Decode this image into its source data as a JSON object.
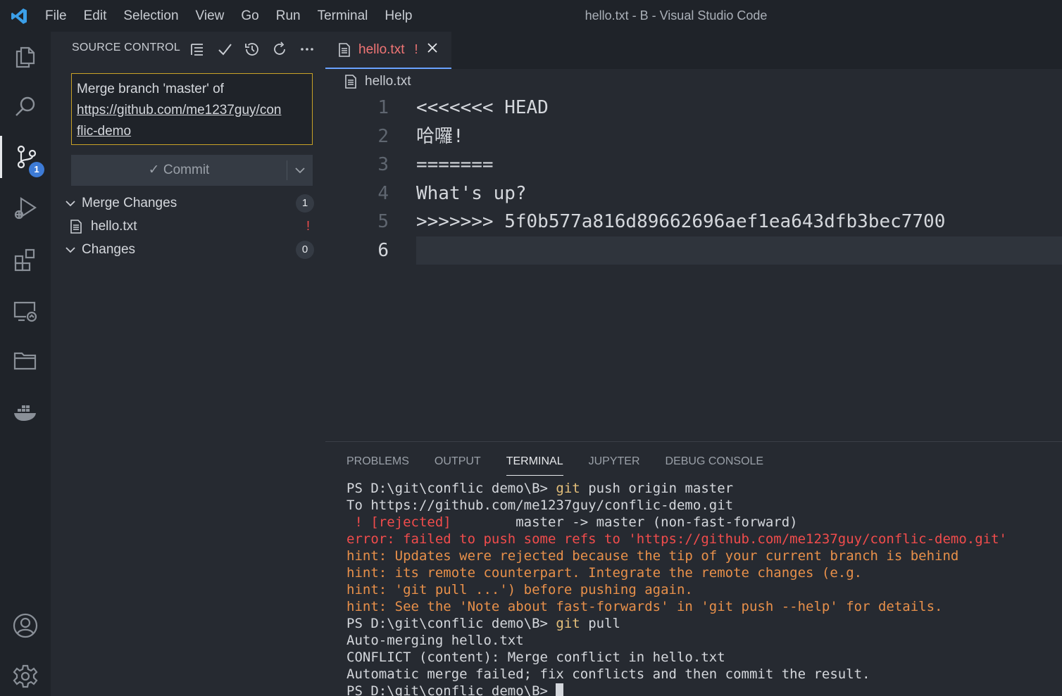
{
  "window": {
    "title": "hello.txt - B - Visual Studio Code"
  },
  "menu": [
    "File",
    "Edit",
    "Selection",
    "View",
    "Go",
    "Run",
    "Terminal",
    "Help"
  ],
  "activity_bar": {
    "items": [
      {
        "icon": "files-icon"
      },
      {
        "icon": "search-icon"
      },
      {
        "icon": "source-control-icon",
        "badge": "1",
        "active": true
      },
      {
        "icon": "run-debug-icon"
      },
      {
        "icon": "extensions-icon"
      },
      {
        "icon": "remote-explorer-icon"
      },
      {
        "icon": "folder-icon"
      },
      {
        "icon": "docker-icon"
      }
    ],
    "bottom": [
      {
        "icon": "account-icon"
      },
      {
        "icon": "gear-icon"
      }
    ]
  },
  "source_control": {
    "header": "SOURCE CONTROL",
    "header_icons": [
      "view-as-tree-icon",
      "check-icon",
      "history-icon",
      "refresh-icon",
      "more-icon"
    ],
    "message_line1": "Merge branch 'master' of",
    "message_line2": "https://github.com/me1237guy/con",
    "message_line3": "flic-demo",
    "commit_label": "✓ Commit",
    "groups": [
      {
        "label": "Merge Changes",
        "count": "1"
      },
      {
        "label": "Changes",
        "count": "0"
      }
    ],
    "file": {
      "name": "hello.txt",
      "status": "!"
    }
  },
  "editor": {
    "tab": {
      "name": "hello.txt",
      "status": "!"
    },
    "breadcrumb": "hello.txt",
    "lines": [
      {
        "n": "1",
        "text": "<<<<<<< HEAD"
      },
      {
        "n": "2",
        "text": "哈囉!"
      },
      {
        "n": "3",
        "text": "======="
      },
      {
        "n": "4",
        "text": "What's up?"
      },
      {
        "n": "5",
        "text": ">>>>>>> 5f0b577a816d89662696aef1ea643dfb3bec7700"
      },
      {
        "n": "6",
        "text": ""
      }
    ]
  },
  "panel": {
    "tabs": [
      "PROBLEMS",
      "OUTPUT",
      "TERMINAL",
      "JUPYTER",
      "DEBUG CONSOLE"
    ],
    "active_tab": "TERMINAL",
    "terminal": {
      "l1_prompt": "PS D:\\git\\conflic demo\\B> ",
      "l1_cmd": "git",
      "l1_args": " push origin master",
      "l2": "To https://github.com/me1237guy/conflic-demo.git",
      "l3_rejected": " ! [rejected]",
      "l3_rest": "        master -> master (non-fast-forward)",
      "l4": "error: failed to push some refs to 'https://github.com/me1237guy/conflic-demo.git'",
      "l5": "hint: Updates were rejected because the tip of your current branch is behind",
      "l6": "hint: its remote counterpart. Integrate the remote changes (e.g.",
      "l7": "hint: 'git pull ...') before pushing again.",
      "l8": "hint: See the 'Note about fast-forwards' in 'git push --help' for details.",
      "l9_prompt": "PS D:\\git\\conflic demo\\B> ",
      "l9_cmd": "git",
      "l9_args": " pull",
      "l10": "Auto-merging hello.txt",
      "l11": "CONFLICT (content): Merge conflict in hello.txt",
      "l12": "Automatic merge failed; fix conflicts and then commit the result.",
      "l13_prompt": "PS D:\\git\\conflic demo\\B> "
    }
  },
  "colors": {
    "accent": "#3d7bd6",
    "conflict": "#f07575",
    "error": "#f14c4c",
    "hint": "#e8904a",
    "command": "#e5c07b"
  }
}
